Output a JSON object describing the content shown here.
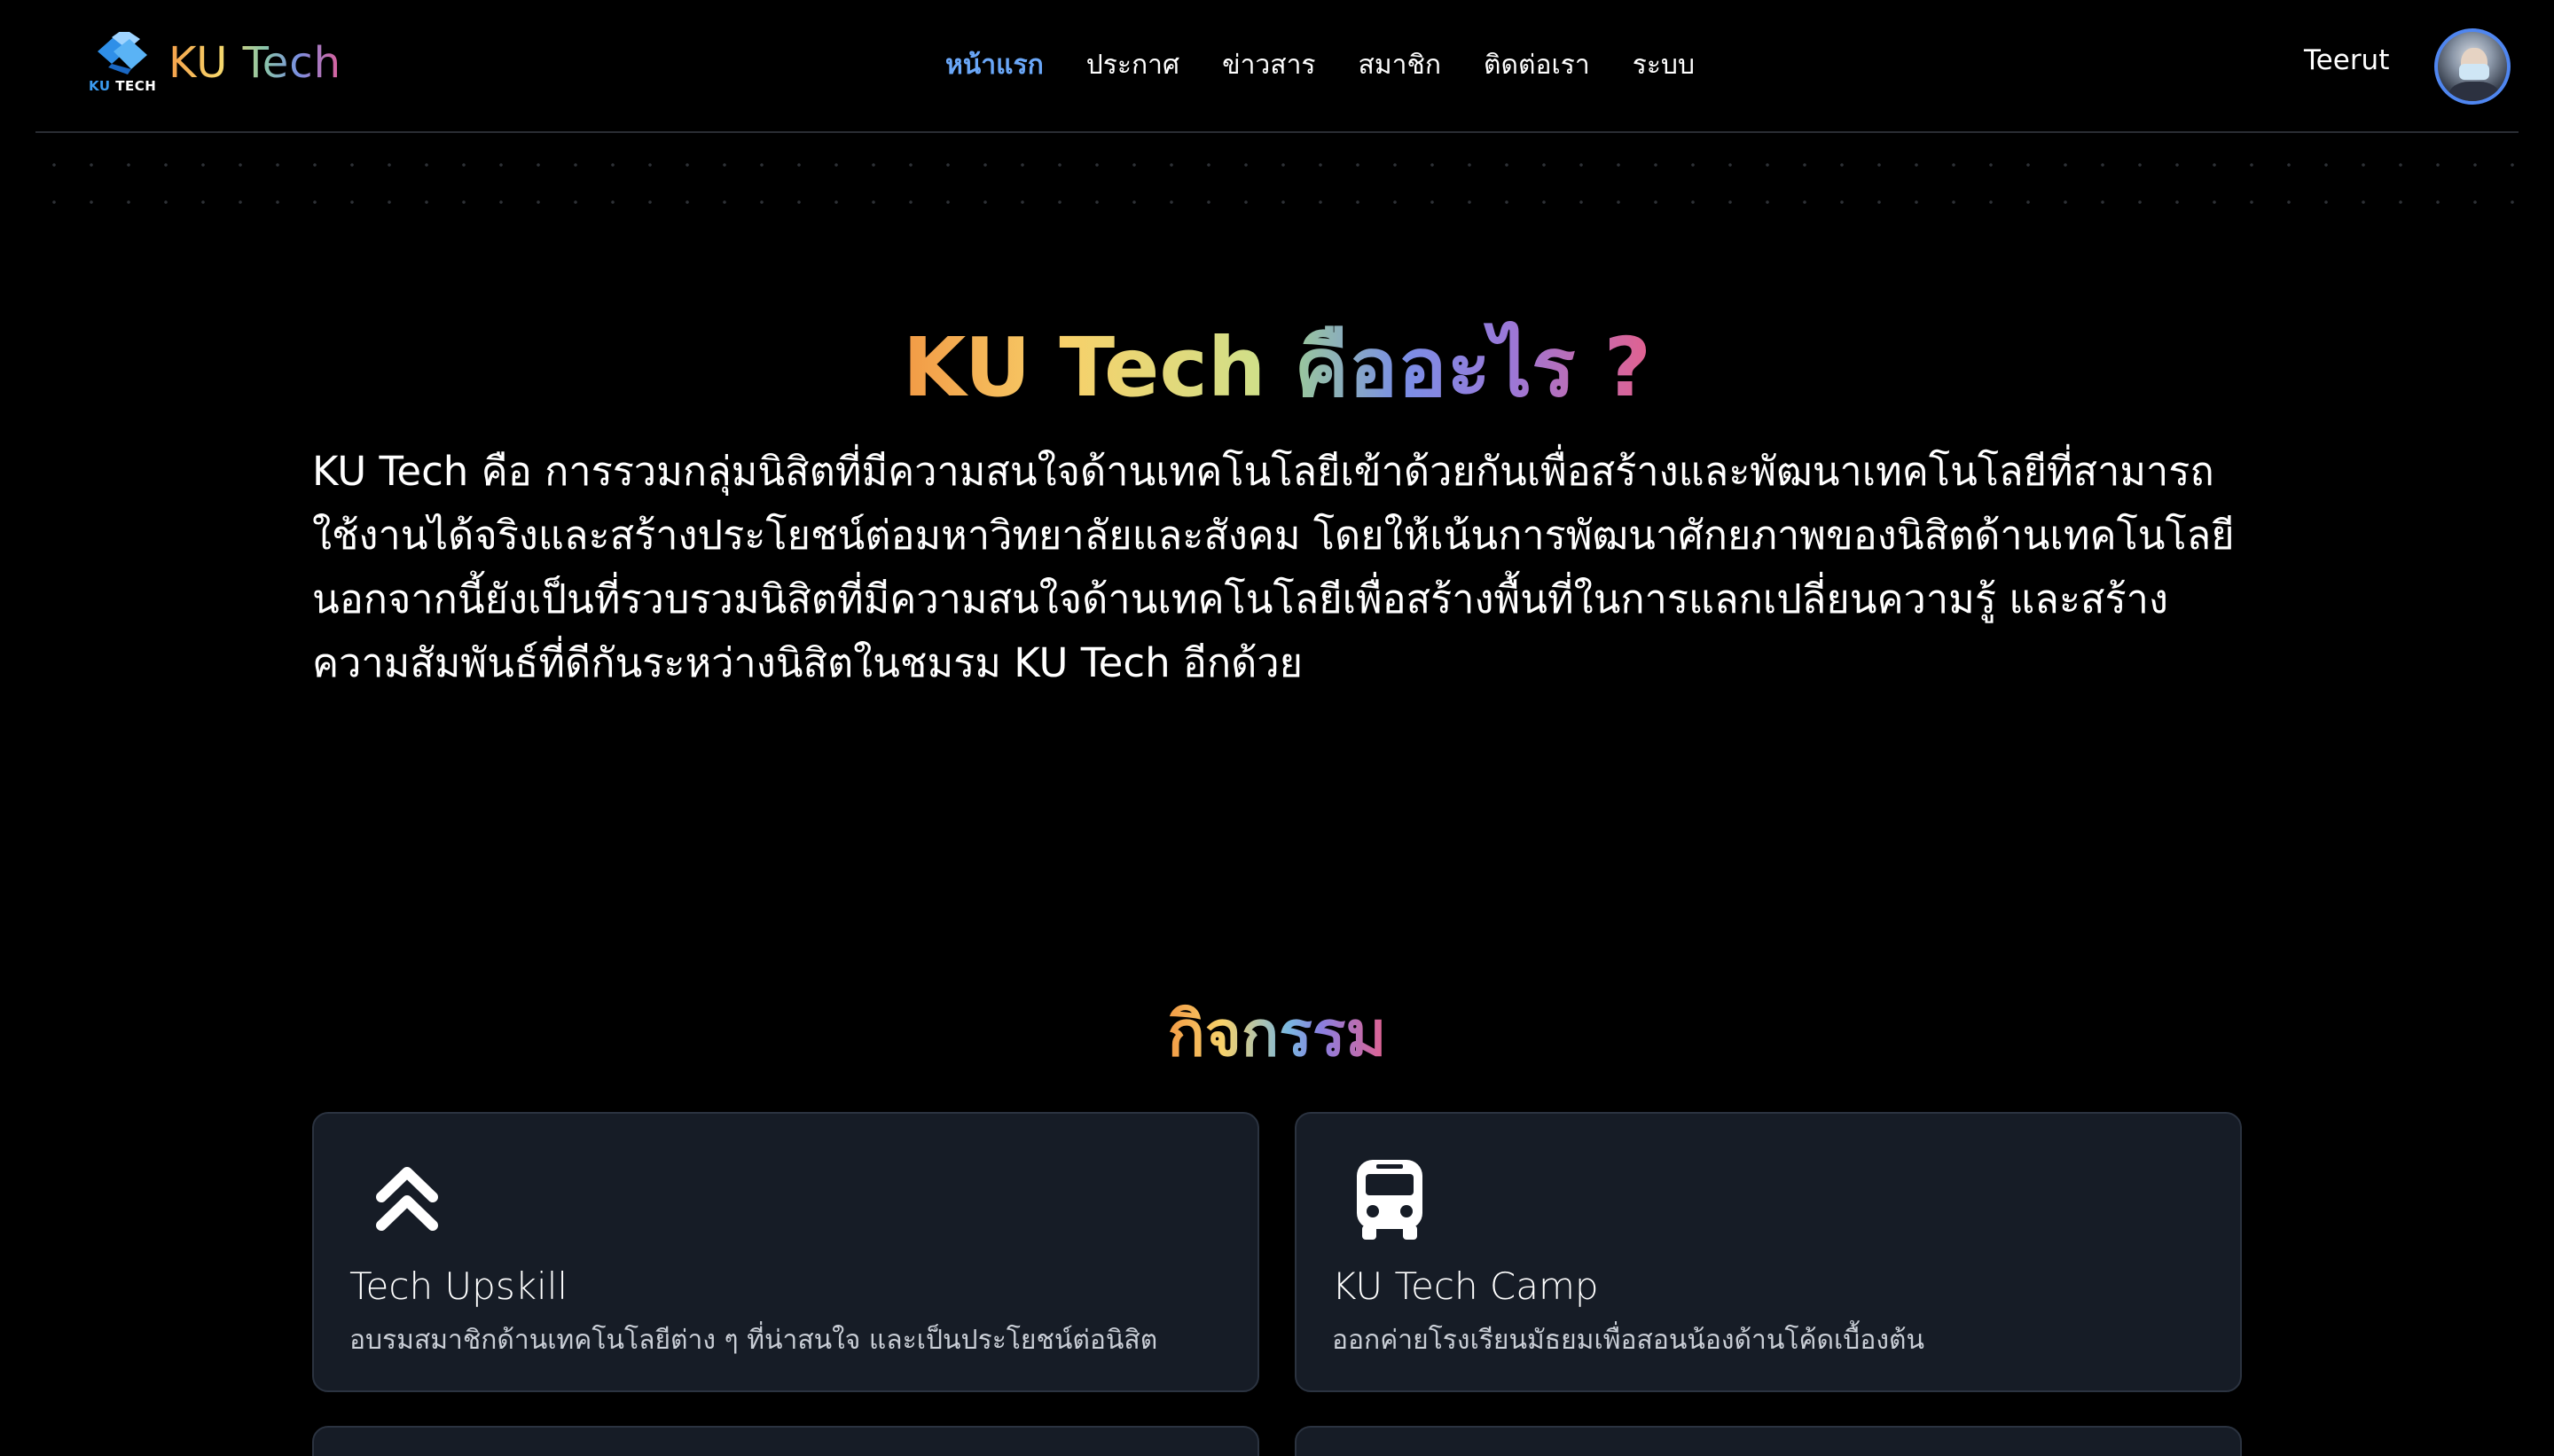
{
  "brand": {
    "name": "KU Tech",
    "mark_tag_ku": "KU",
    "mark_tag_tech": "TECH"
  },
  "nav": {
    "items": [
      {
        "label": "หน้าแรก",
        "active": true
      },
      {
        "label": "ประกาศ",
        "active": false
      },
      {
        "label": "ข่าวสาร",
        "active": false
      },
      {
        "label": "สมาชิก",
        "active": false
      },
      {
        "label": "ติดต่อเรา",
        "active": false
      },
      {
        "label": "ระบบ",
        "active": false
      }
    ],
    "active_color": "#6aa7f8"
  },
  "user": {
    "name": "Teerut"
  },
  "hero": {
    "title_part1": "KU Tech",
    "title_part2": "คืออะไร ?",
    "description": "KU Tech คือ การรวมกลุ่มนิสิตที่มีความสนใจด้านเทคโนโลยีเข้าด้วยกันเพื่อสร้างและพัฒนาเทคโนโลยีที่สามารถใช้งานได้จริงและสร้างประโยชน์ต่อมหาวิทยาลัยและสังคม โดยให้เน้นการพัฒนาศักยภาพของนิสิตด้านเทคโนโลยี นอกจากนี้ยังเป็นที่รวบรวมนิสิตที่มีความสนใจด้านเทคโนโลยีเพื่อสร้างพื้นที่ในการแลกเปลี่ยนความรู้ และสร้างความสัมพันธ์ที่ดีกันระหว่างนิสิตในชมรม KU Tech อีกด้วย"
  },
  "activities": {
    "title": "กิจกรรม",
    "cards": [
      {
        "icon": "double-chevron-up-icon",
        "title": "Tech Upskill",
        "description": "อบรมสมาชิกด้านเทคโนโลยีต่าง ๆ ที่น่าสนใจ และเป็นประโยชน์ต่อนิสิต"
      },
      {
        "icon": "bus-icon",
        "title": "KU Tech Camp",
        "description": "ออกค่ายโรงเรียนมัธยมเพื่อสอนน้องด้านโค้ดเบื้องต้น"
      }
    ]
  },
  "colors": {
    "background": "#000000",
    "card_bg": "#161c26",
    "card_border": "#2b3340"
  }
}
